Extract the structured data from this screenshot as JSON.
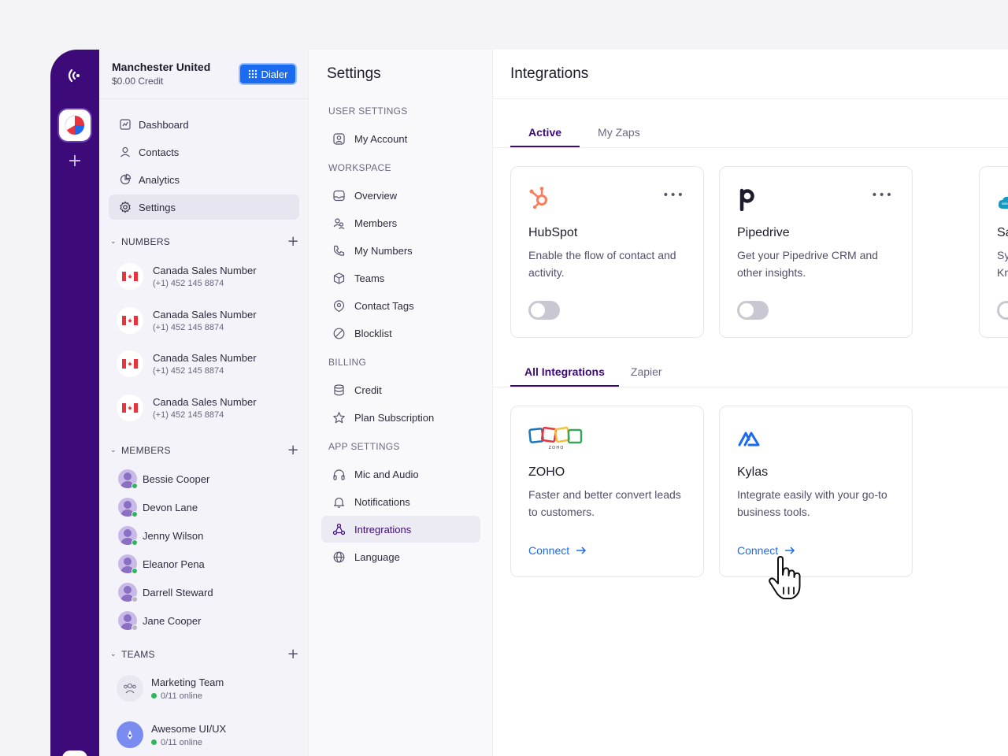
{
  "account": {
    "name": "Manchester United",
    "credit": "$0.00 Credit",
    "dialer_label": "Dialer"
  },
  "nav": {
    "items": [
      {
        "label": "Dashboard",
        "icon": "dashboard-icon"
      },
      {
        "label": "Contacts",
        "icon": "user-icon"
      },
      {
        "label": "Analytics",
        "icon": "pie-chart-icon"
      },
      {
        "label": "Settings",
        "icon": "gear-icon"
      }
    ]
  },
  "numbers": {
    "heading": "NUMBERS",
    "items": [
      {
        "name": "Canada Sales Number",
        "phone": "(+1) 452 145 8874"
      },
      {
        "name": "Canada Sales Number",
        "phone": "(+1) 452 145 8874"
      },
      {
        "name": "Canada Sales Number",
        "phone": "(+1) 452 145 8874"
      },
      {
        "name": "Canada Sales Number",
        "phone": "(+1) 452 145 8874"
      }
    ]
  },
  "members": {
    "heading": "MEMBERS",
    "items": [
      {
        "name": "Bessie Cooper",
        "online": true
      },
      {
        "name": "Devon Lane",
        "online": true
      },
      {
        "name": "Jenny Wilson",
        "online": true
      },
      {
        "name": "Eleanor Pena",
        "online": true
      },
      {
        "name": "Darrell Steward",
        "online": false
      },
      {
        "name": "Jane Cooper",
        "online": false
      }
    ]
  },
  "teams": {
    "heading": "TEAMS",
    "items": [
      {
        "name": "Marketing Team",
        "status": "0/11 online"
      },
      {
        "name": "Awesome UI/UX",
        "status": "0/11 online"
      }
    ]
  },
  "settings": {
    "title": "Settings",
    "sections": {
      "user": "USER SETTINGS",
      "workspace": "WORKSPACE",
      "billing": "BILLING",
      "app": "APP SETTINGS"
    },
    "items": {
      "my_account": "My Account",
      "overview": "Overview",
      "members": "Members",
      "my_numbers": "My Numbers",
      "teams": "Teams",
      "contact_tags": "Contact Tags",
      "blocklist": "Blocklist",
      "credit": "Credit",
      "plan_subscription": "Plan Subscription",
      "mic_audio": "Mic and Audio",
      "notifications": "Notifications",
      "integrations": "Intregrations",
      "language": "Language"
    }
  },
  "main": {
    "title": "Integrations",
    "top_tabs": [
      "Active",
      "My Zaps"
    ],
    "active_cards": [
      {
        "title": "HubSpot",
        "desc": "Enable the flow of contact and activity.",
        "enabled": false,
        "more": "•••"
      },
      {
        "title": "Pipedrive",
        "desc": "Get your Pipedrive CRM and other insights.",
        "enabled": false,
        "more": "•••"
      },
      {
        "title": "Salesforce",
        "desc": "Sync contac KrispCall an",
        "enabled": false
      }
    ],
    "bottom_tabs": [
      "All Integrations",
      "Zapier"
    ],
    "all_cards": [
      {
        "title": "ZOHO",
        "desc": "Faster and better convert leads to customers.",
        "action": "Connect"
      },
      {
        "title": "Kylas",
        "desc": "Integrate easily with your go-to business tools.",
        "action": "Connect"
      }
    ],
    "logo_texts": {
      "zoho": "Z O H O",
      "salesforce": "salesforce"
    }
  },
  "colors": {
    "brand": "#3d0a7a",
    "accent": "#1a6bf0",
    "online": "#2fb55c",
    "hubspot": "#ff7a59"
  }
}
